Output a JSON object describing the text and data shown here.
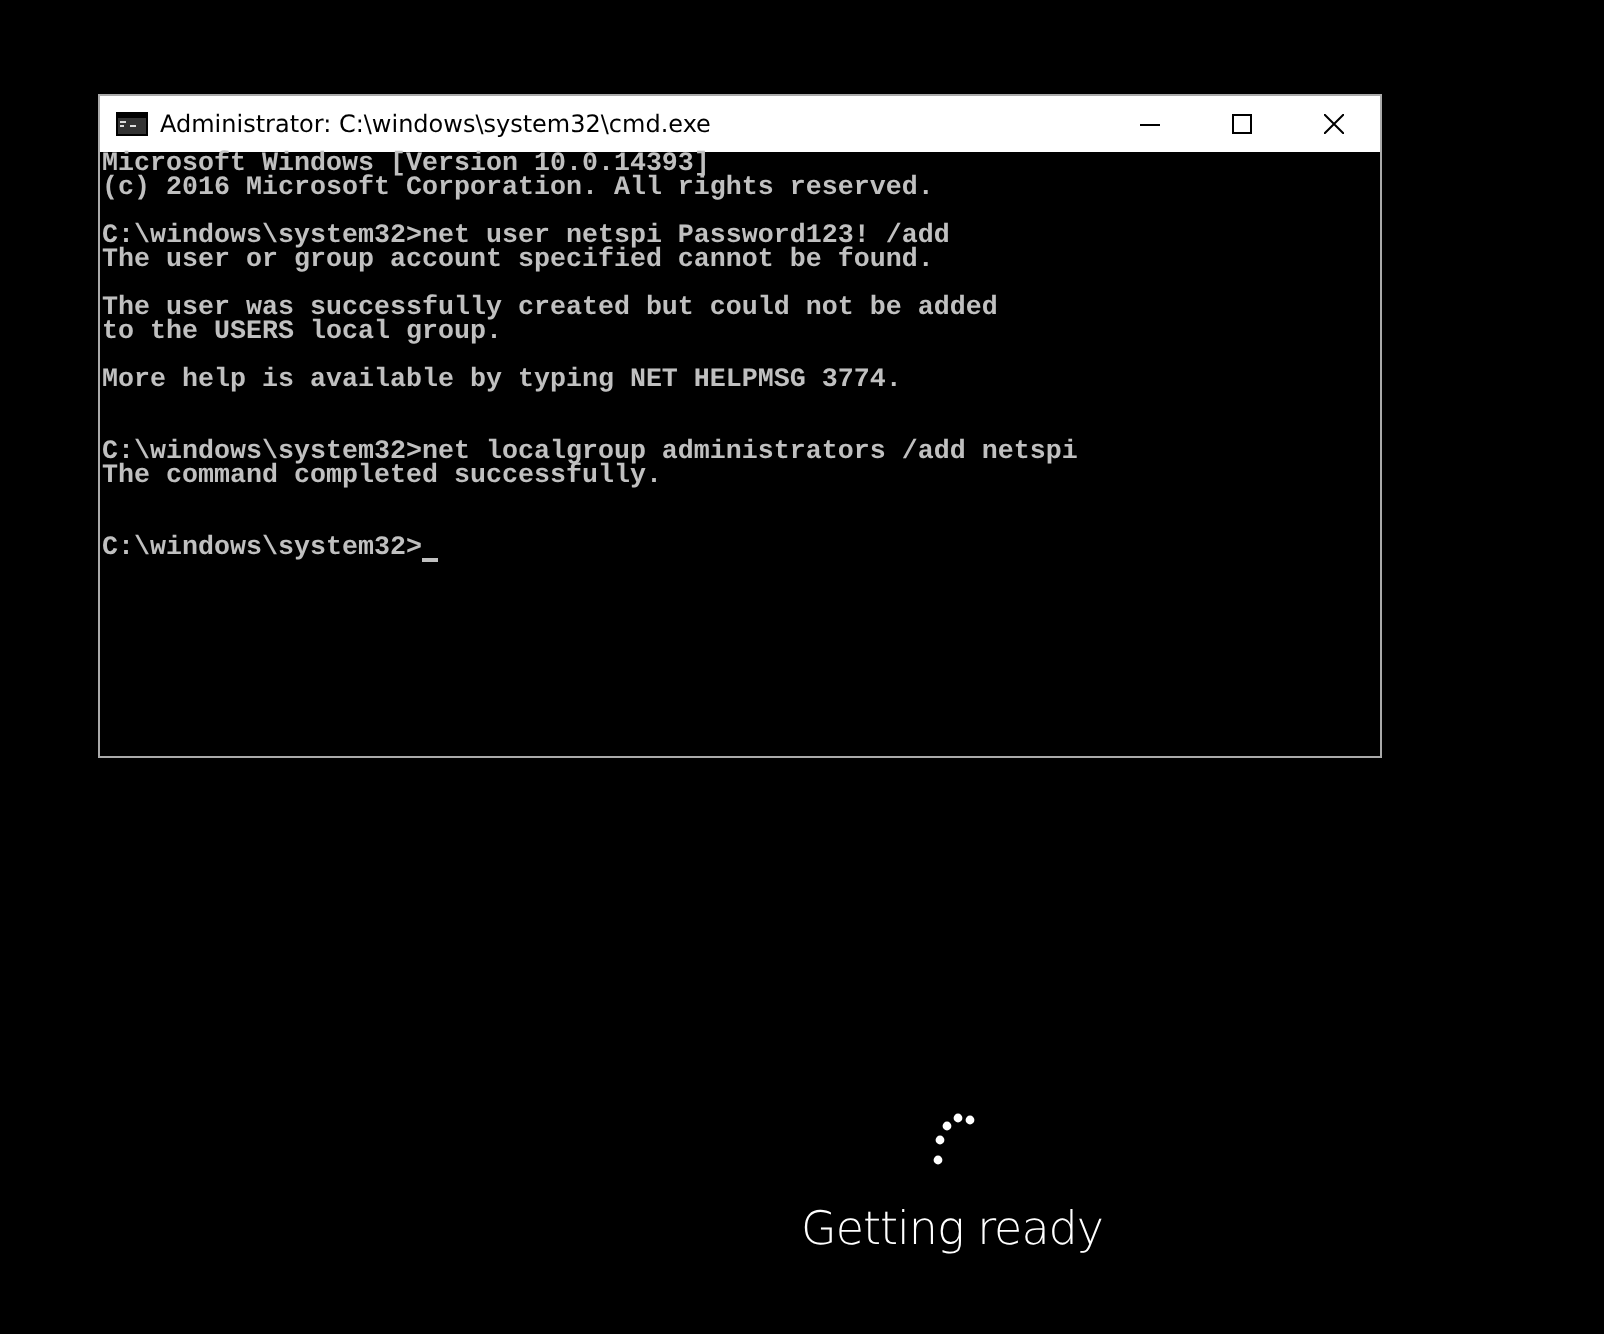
{
  "window": {
    "title": "Administrator: C:\\windows\\system32\\cmd.exe"
  },
  "console": {
    "lines": [
      {
        "kind": "output",
        "text": "Microsoft Windows [Version 10.0.14393]"
      },
      {
        "kind": "output",
        "text": "(c) 2016 Microsoft Corporation. All rights reserved."
      },
      {
        "kind": "blank"
      },
      {
        "kind": "output",
        "text": "C:\\windows\\system32>net user netspi Password123! /add"
      },
      {
        "kind": "output",
        "text": "The user or group account specified cannot be found."
      },
      {
        "kind": "blank"
      },
      {
        "kind": "output",
        "text": "The user was successfully created but could not be added"
      },
      {
        "kind": "output",
        "text": "to the USERS local group."
      },
      {
        "kind": "blank"
      },
      {
        "kind": "output",
        "text": "More help is available by typing NET HELPMSG 3774."
      },
      {
        "kind": "blank"
      },
      {
        "kind": "blank"
      },
      {
        "kind": "output",
        "text": "C:\\windows\\system32>net localgroup administrators /add netspi"
      },
      {
        "kind": "output",
        "text": "The command completed successfully."
      },
      {
        "kind": "blank"
      },
      {
        "kind": "blank"
      },
      {
        "kind": "prompt",
        "text": "C:\\windows\\system32>",
        "cursor": true
      }
    ]
  },
  "status": {
    "message": "Getting ready"
  }
}
